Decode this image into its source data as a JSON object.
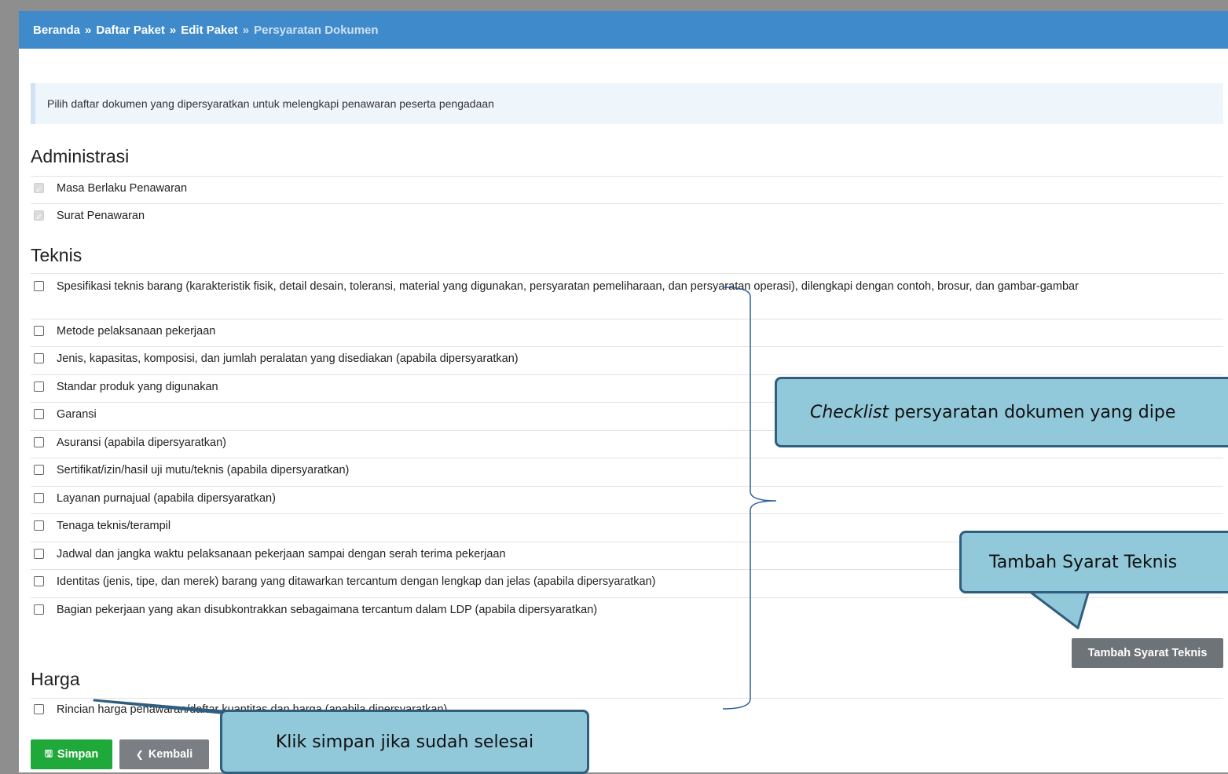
{
  "breadcrumb": {
    "items": [
      "Beranda",
      "Daftar Paket",
      "Edit Paket"
    ],
    "current": "Persyaratan Dokumen",
    "separator": "»"
  },
  "info_text": "Pilih daftar dokumen yang dipersyaratkan untuk melengkapi penawaran peserta pengadaan",
  "sections": {
    "administrasi": {
      "title": "Administrasi",
      "items": [
        "Masa Berlaku Penawaran",
        "Surat Penawaran"
      ]
    },
    "teknis": {
      "title": "Teknis",
      "items": [
        "Spesifikasi teknis barang (karakteristik fisik, detail desain, toleransi, material yang digunakan, persyaratan pemeliharaan, dan persyaratan operasi), dilengkapi dengan contoh, brosur, dan gambar-gambar",
        "Metode pelaksanaan pekerjaan",
        "Jenis, kapasitas, komposisi, dan jumlah peralatan yang disediakan (apabila dipersyaratkan)",
        "Standar produk yang digunakan",
        "Garansi",
        "Asuransi (apabila dipersyaratkan)",
        "Sertifikat/izin/hasil uji mutu/teknis (apabila dipersyaratkan)",
        "Layanan purnajual (apabila dipersyaratkan)",
        "Tenaga teknis/terampil",
        "Jadwal dan jangka waktu pelaksanaan pekerjaan sampai dengan serah terima pekerjaan",
        "Identitas (jenis, tipe, dan merek) barang yang ditawarkan tercantum dengan lengkap dan jelas (apabila dipersyaratkan)",
        "Bagian pekerjaan yang akan disubkontrakkan sebagaimana tercantum dalam LDP (apabila dipersyaratkan)"
      ]
    },
    "harga": {
      "title": "Harga",
      "items": [
        "Rincian harga penawaran/daftar kuantitas dan harga (apabila dipersyaratkan)"
      ]
    }
  },
  "buttons": {
    "tambah_syarat_teknis": "Tambah Syarat Teknis",
    "simpan": "Simpan",
    "kembali": "Kembali"
  },
  "callouts": {
    "checklist_em": "Checklist",
    "checklist_rest": " persyaratan dokumen yang dipe",
    "tambah": "Tambah Syarat Teknis",
    "simpan": "Klik simpan jika sudah selesai"
  },
  "colors": {
    "header_bar": "#3f8acb",
    "callout_fill": "#91c8da",
    "callout_border": "#2f5e7e",
    "simpan_button": "#1ea93a",
    "brace": "#2f5e9e"
  },
  "icons": {
    "simpan": "floppy-disk-icon",
    "kembali": "arrow-circle-left-icon"
  }
}
